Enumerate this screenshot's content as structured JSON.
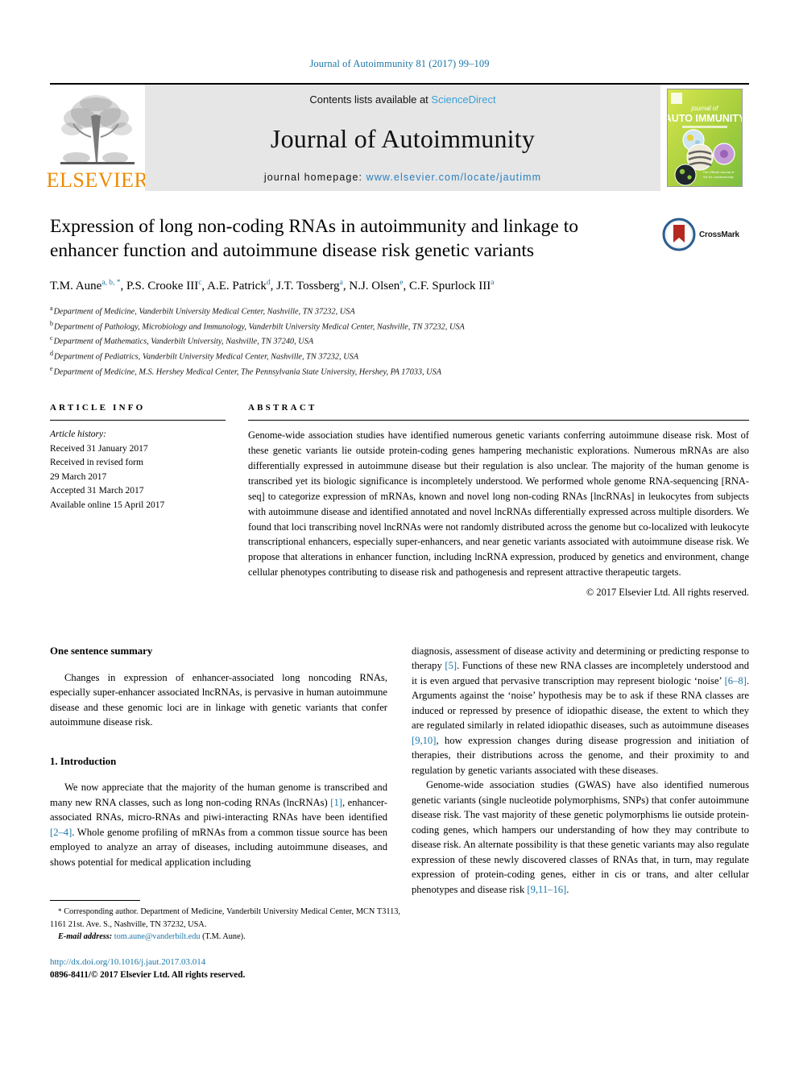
{
  "running_head": "Journal of Autoimmunity 81 (2017) 99–109",
  "banner": {
    "publisher_logo_text": "ELSEVIER",
    "contents_prefix": "Contents lists available at ",
    "contents_link": "ScienceDirect",
    "journal_name": "Journal of Autoimmunity",
    "homepage_prefix": "journal homepage: ",
    "homepage_url": "www.elsevier.com/locate/jautimm",
    "cover": {
      "line1": "journal of",
      "line2": "AUTO IMMUNITY",
      "subtitle": "the journal of translational autoimmunity"
    }
  },
  "title": "Expression of long non-coding RNAs in autoimmunity and linkage to enhancer function and autoimmune disease risk genetic variants",
  "crossmark_label": "CrossMark",
  "authors": [
    {
      "name": "T.M. Aune",
      "marks": "a, b, *"
    },
    {
      "name": "P.S. Crooke III",
      "marks": "c"
    },
    {
      "name": "A.E. Patrick",
      "marks": "d"
    },
    {
      "name": "J.T. Tossberg",
      "marks": "a"
    },
    {
      "name": "N.J. Olsen",
      "marks": "e"
    },
    {
      "name": "C.F. Spurlock III",
      "marks": "a"
    }
  ],
  "affiliations": [
    {
      "label": "a",
      "text": "Department of Medicine, Vanderbilt University Medical Center, Nashville, TN 37232, USA"
    },
    {
      "label": "b",
      "text": "Department of Pathology, Microbiology and Immunology, Vanderbilt University Medical Center, Nashville, TN 37232, USA"
    },
    {
      "label": "c",
      "text": "Department of Mathematics, Vanderbilt University, Nashville, TN 37240, USA"
    },
    {
      "label": "d",
      "text": "Department of Pediatrics, Vanderbilt University Medical Center, Nashville, TN 37232, USA"
    },
    {
      "label": "e",
      "text": "Department of Medicine, M.S. Hershey Medical Center, The Pennsylvania State University, Hershey, PA 17033, USA"
    }
  ],
  "article_info": {
    "heading": "ARTICLE INFO",
    "history_label": "Article history:",
    "history": [
      "Received 31 January 2017",
      "Received in revised form",
      "29 March 2017",
      "Accepted 31 March 2017",
      "Available online 15 April 2017"
    ]
  },
  "abstract": {
    "heading": "ABSTRACT",
    "text": "Genome-wide association studies have identified numerous genetic variants conferring autoimmune disease risk. Most of these genetic variants lie outside protein-coding genes hampering mechanistic explorations. Numerous mRNAs are also differentially expressed in autoimmune disease but their regulation is also unclear. The majority of the human genome is transcribed yet its biologic significance is incompletely understood. We performed whole genome RNA-sequencing [RNA-seq] to categorize expression of mRNAs, known and novel long non-coding RNAs [lncRNAs] in leukocytes from subjects with autoimmune disease and identified annotated and novel lncRNAs differentially expressed across multiple disorders. We found that loci transcribing novel lncRNAs were not randomly distributed across the genome but co-localized with leukocyte transcriptional enhancers, especially super-enhancers, and near genetic variants associated with autoimmune disease risk. We propose that alterations in enhancer function, including lncRNA expression, produced by genetics and environment, change cellular phenotypes contributing to disease risk and pathogenesis and represent attractive therapeutic targets.",
    "copyright": "© 2017 Elsevier Ltd. All rights reserved."
  },
  "one_sentence_summary": {
    "heading": "One sentence summary",
    "text": "Changes in expression of enhancer-associated long noncoding RNAs, especially super-enhancer associated lncRNAs, is pervasive in human autoimmune disease and these genomic loci are in linkage with genetic variants that confer autoimmune disease risk."
  },
  "introduction": {
    "heading": "1. Introduction",
    "para1_a": "We now appreciate that the majority of the human genome is transcribed and many new RNA classes, such as long non-coding RNAs (lncRNAs) ",
    "ref1": "[1]",
    "para1_b": ", enhancer-associated RNAs, micro-RNAs and piwi-interacting RNAs have been identified ",
    "ref2": "[2–4]",
    "para1_c": ". Whole genome profiling of mRNAs from a common tissue source has been employed to analyze an array of diseases, including autoimmune diseases, and shows potential for medical application including"
  },
  "right_column": {
    "para1_a": "diagnosis, assessment of disease activity and determining or predicting response to therapy ",
    "ref5": "[5]",
    "para1_b": ". Functions of these new RNA classes are incompletely understood and it is even argued that pervasive transcription may represent biologic ‘noise’ ",
    "ref6": "[6–8]",
    "para1_c": ". Arguments against the ‘noise’ hypothesis may be to ask if these RNA classes are induced or repressed by presence of idiopathic disease, the extent to which they are regulated similarly in related idiopathic diseases, such as autoimmune diseases ",
    "ref9": "[9,10]",
    "para1_d": ", how expression changes during disease progression and initiation of therapies, their distributions across the genome, and their proximity to and regulation by genetic variants associated with these diseases.",
    "para2_a": "Genome-wide association studies (GWAS) have also identified numerous genetic variants (single nucleotide polymorphisms, SNPs) that confer autoimmune disease risk. The vast majority of these genetic polymorphisms lie outside protein-coding genes, which hampers our understanding of how they may contribute to disease risk. An alternate possibility is that these genetic variants may also regulate expression of these newly discovered classes of RNAs that, in turn, may regulate expression of protein-coding genes, either in cis or trans, and alter cellular phenotypes and disease risk ",
    "ref11": "[9,11–16]",
    "para2_b": "."
  },
  "footnotes": {
    "star": "*",
    "corresponding": " Corresponding author. Department of Medicine, Vanderbilt University Medical Center, MCN T3113, 1161 21st. Ave. S., Nashville, TN 37232, USA.",
    "email_label": "E-mail address:",
    "email": "tom.aune@vanderbilt.edu",
    "email_suffix": " (T.M. Aune).",
    "doi": "http://dx.doi.org/10.1016/j.jaut.2017.03.014",
    "issn_line": "0896-8411/© 2017 Elsevier Ltd. All rights reserved."
  },
  "colors": {
    "link_blue": "#1b76a8",
    "sciencedirect_blue": "#3aa0d6",
    "elsevier_orange": "#ED8B00",
    "banner_grey": "#e6e6e6"
  }
}
